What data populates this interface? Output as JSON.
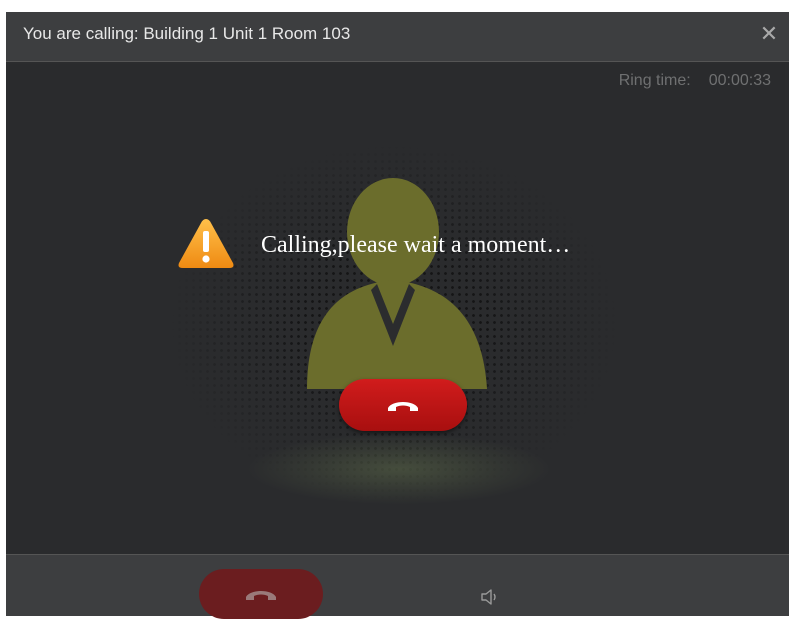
{
  "window": {
    "title": "You are calling: Building 1 Unit 1 Room 103",
    "close_symbol": "✕"
  },
  "call": {
    "ring_time_label": "Ring time:",
    "ring_time_value": "00:00:33",
    "status_message": "Calling,please wait a moment…"
  },
  "icons": {
    "close": "close-icon",
    "warning": "warning-icon",
    "avatar": "person-avatar-icon",
    "hangup": "phone-hangup-icon",
    "speaker": "speaker-icon"
  },
  "colors": {
    "background": "#2b2c2e",
    "title_bar": "#3d3e40",
    "avatar_green": "#6b6d2c",
    "hangup_red": "#c11414",
    "hangup_disabled": "#6b1d1f",
    "warning_orange": "#f39a1b"
  }
}
